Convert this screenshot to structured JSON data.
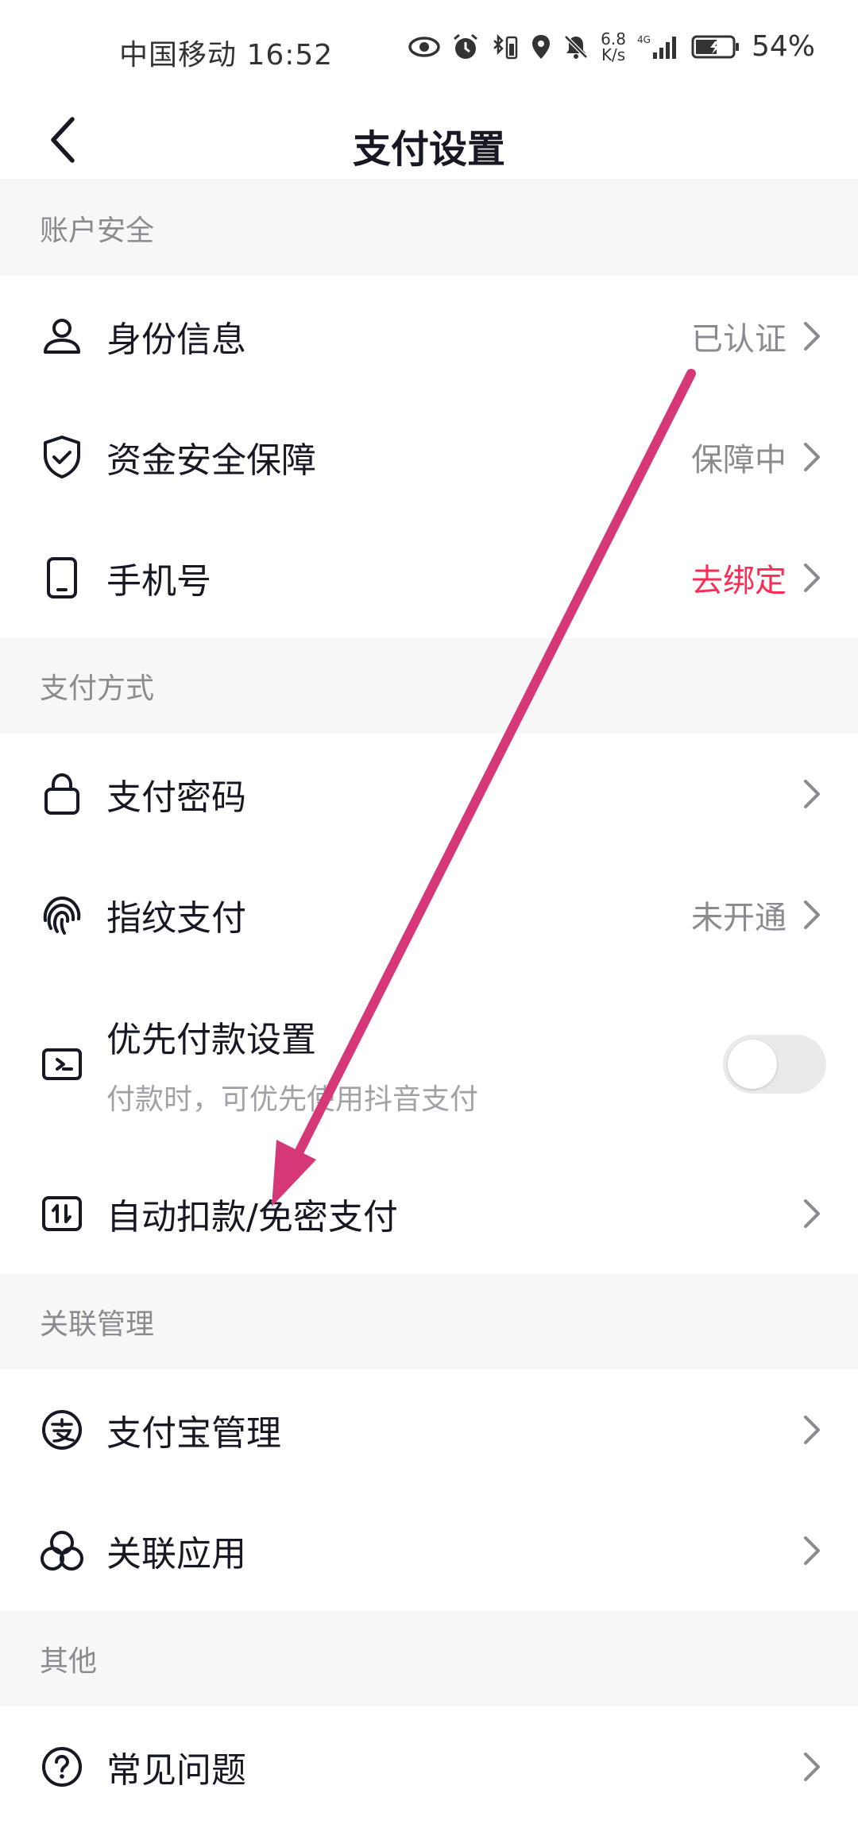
{
  "status_bar": {
    "carrier_time": "中国移动 16:52",
    "net_speed_top": "6.8",
    "net_speed_bottom": "K/s",
    "network": "4G",
    "battery": "54%"
  },
  "nav": {
    "title": "支付设置"
  },
  "sections": {
    "account_security": {
      "header": "账户安全",
      "identity": {
        "label": "身份信息",
        "value": "已认证"
      },
      "fund_safety": {
        "label": "资金安全保障",
        "value": "保障中"
      },
      "phone": {
        "label": "手机号",
        "value": "去绑定"
      }
    },
    "payment_methods": {
      "header": "支付方式",
      "password": {
        "label": "支付密码"
      },
      "fingerprint": {
        "label": "指纹支付",
        "value": "未开通"
      },
      "priority": {
        "label": "优先付款设置",
        "sub": "付款时，可优先使用抖音支付",
        "enabled": false
      },
      "auto_deduct": {
        "label": "自动扣款/免密支付"
      }
    },
    "linked": {
      "header": "关联管理",
      "alipay": {
        "label": "支付宝管理"
      },
      "apps": {
        "label": "关联应用"
      }
    },
    "other": {
      "header": "其他",
      "faq": {
        "label": "常见问题"
      }
    }
  },
  "colors": {
    "accent_red": "#fe2c55",
    "annotation_arrow": "#d63877",
    "section_bg": "#f7f7f8"
  }
}
